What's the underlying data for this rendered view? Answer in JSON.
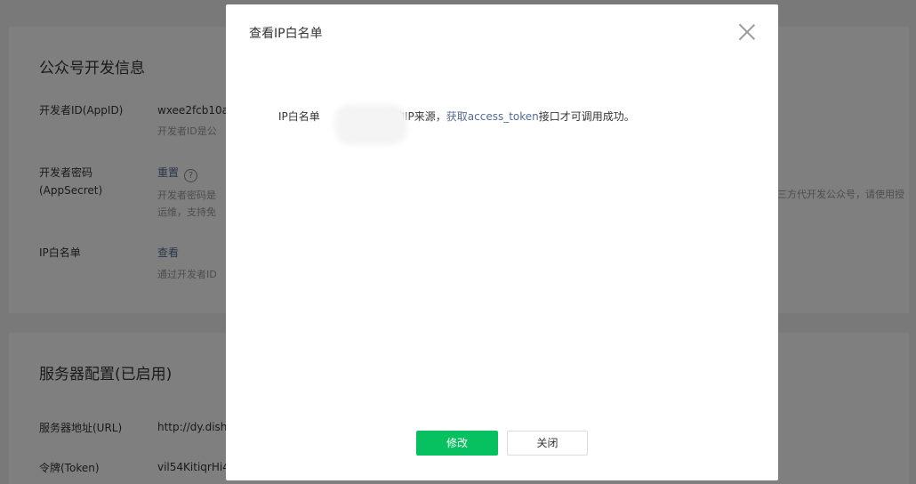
{
  "background": {
    "dev_card": {
      "title": "公众号开发信息",
      "app_id": {
        "label": "开发者ID(AppID)",
        "value": "wxee2fcb10a",
        "desc": "开发者ID是公"
      },
      "app_secret": {
        "label": "开发者密码(AppSecret)",
        "action": "重置",
        "help_icon": "?",
        "desc_line1": "开发者密码是",
        "desc_line2": "运维，支持免",
        "side_note": "三方代开发公众号，请使用授"
      },
      "ip_whitelist": {
        "label": "IP白名单",
        "action": "查看",
        "desc": "通过开发者ID"
      }
    },
    "server_card": {
      "title": "服务器配置(已启用)",
      "url": {
        "label": "服务器地址(URL)",
        "value": "http://dy.dish"
      },
      "token": {
        "label": "令牌(Token)",
        "value": "vil54KitiqrHi4"
      }
    }
  },
  "dialog": {
    "title": "查看IP白名单",
    "field_label": "IP白名单",
    "text_before": "的IP来源，",
    "link_text": "获取access_token",
    "text_after": "接口才可调用成功。",
    "confirm_label": "修改",
    "close_label": "关闭"
  },
  "colors": {
    "primary": "#07c160",
    "link": "#576b95"
  }
}
